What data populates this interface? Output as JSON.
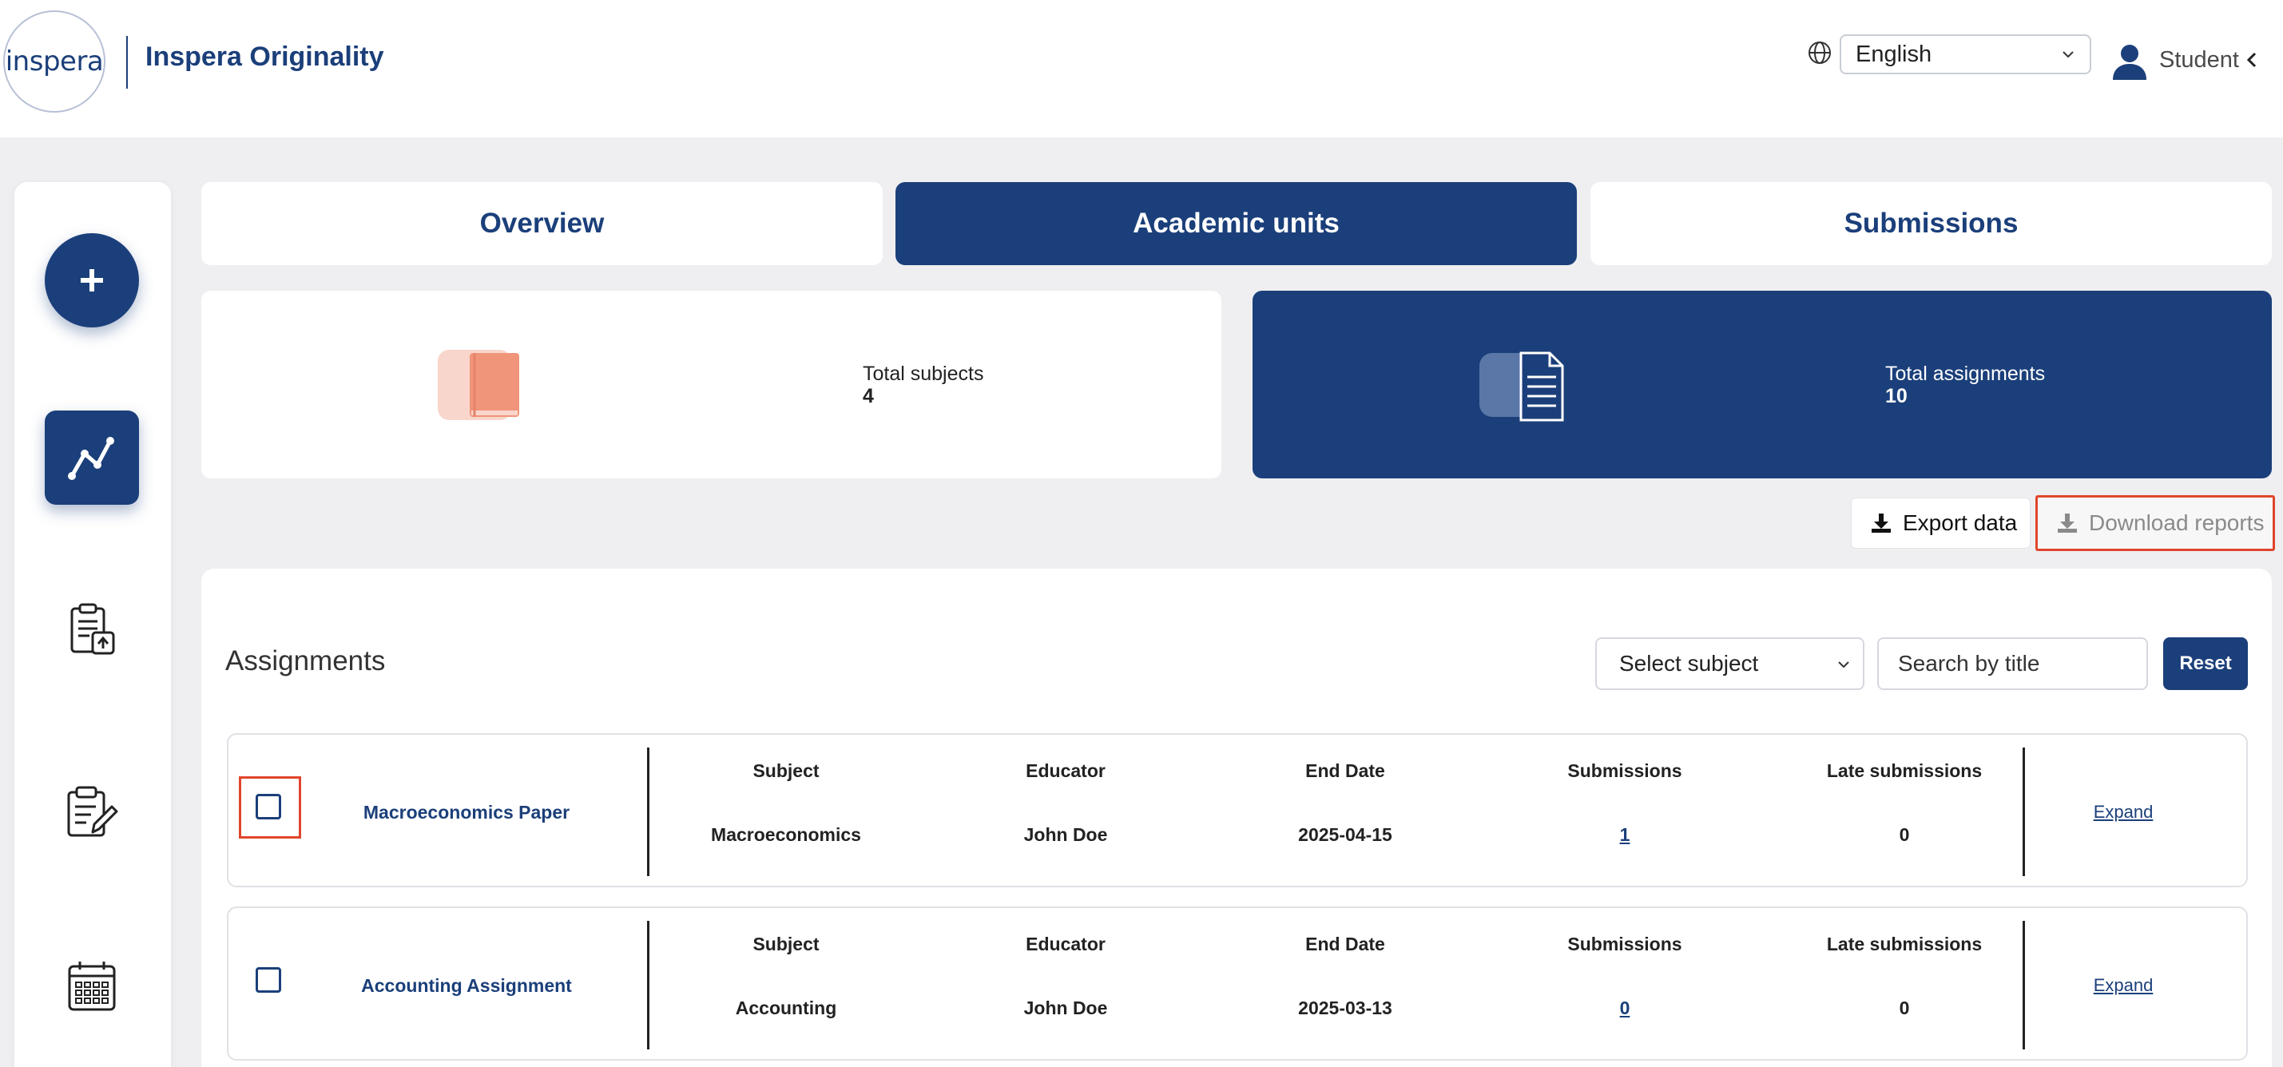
{
  "header": {
    "logo_text": "inspera",
    "brand": "Inspera Originality",
    "language": "English",
    "user_label": "Student"
  },
  "tabs": [
    {
      "label": "Overview",
      "active": false
    },
    {
      "label": "Academic units",
      "active": true
    },
    {
      "label": "Submissions",
      "active": false
    }
  ],
  "stats": {
    "subjects_label": "Total subjects",
    "subjects_value": "4",
    "assignments_label": "Total assignments",
    "assignments_value": "10"
  },
  "actions": {
    "export_label": "Export data",
    "download_label": "Download reports"
  },
  "assignments": {
    "title": "Assignments",
    "select_subject": "Select subject",
    "search_placeholder": "Search by title",
    "reset_label": "Reset",
    "columns": [
      "Subject",
      "Educator",
      "End Date",
      "Submissions",
      "Late submissions"
    ],
    "expand_label": "Expand",
    "rows": [
      {
        "title": "Macroeconomics Paper",
        "subject": "Macroeconomics",
        "educator": "John Doe",
        "end_date": "2025-04-15",
        "submissions": "1",
        "late": "0"
      },
      {
        "title": "Accounting Assignment",
        "subject": "Accounting",
        "educator": "John Doe",
        "end_date": "2025-03-13",
        "submissions": "0",
        "late": "0"
      }
    ]
  },
  "colors": {
    "primary": "#1b3f7a",
    "background": "#efeff1",
    "highlight": "#e0452c",
    "book_icon": "#f0957a"
  }
}
